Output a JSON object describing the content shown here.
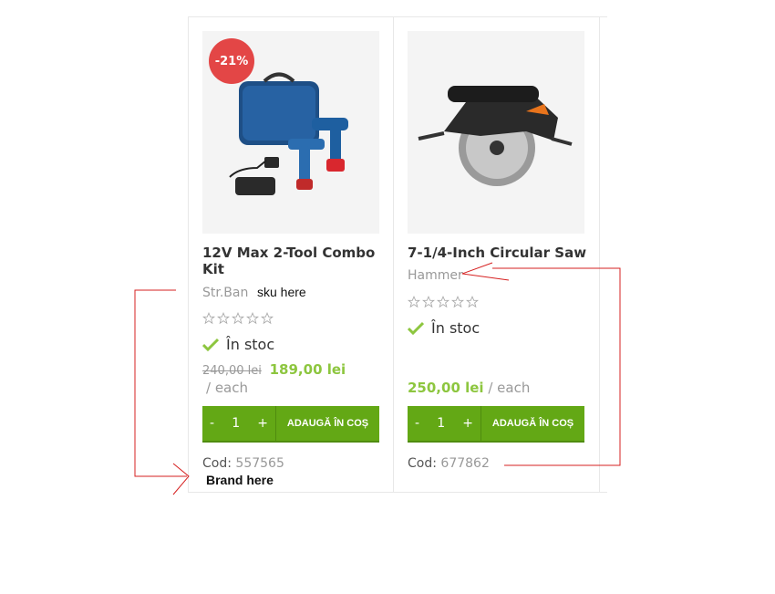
{
  "products": [
    {
      "discount_badge": "-21%",
      "title_line1": "12V Max 2-Tool Combo",
      "title_line2": "Kit",
      "brand": "Str.Ban",
      "sku_note": "sku here",
      "stock": "În stoc",
      "old_price": "240,00 lei",
      "price": "189,00 lei",
      "unit": "/ each",
      "qty_minus": "-",
      "qty": "1",
      "qty_plus": "+",
      "add_to_cart": "ADAUGĂ ÎN COȘ",
      "code_label": "Cod:",
      "code_value": "557565",
      "brand_note": "Brand here"
    },
    {
      "title_line1": "7-1/4-Inch Circular Saw",
      "brand": "Hammer",
      "stock": "În stoc",
      "price": "250,00 lei",
      "unit": "/ each",
      "qty_minus": "-",
      "qty": "1",
      "qty_plus": "+",
      "add_to_cart": "ADAUGĂ ÎN COȘ",
      "code_label": "Cod:",
      "code_value": "677862"
    }
  ],
  "colors": {
    "badge": "#e34646",
    "price": "#8dc63f",
    "cart_button": "#63a815",
    "annotation": "#d62020"
  }
}
